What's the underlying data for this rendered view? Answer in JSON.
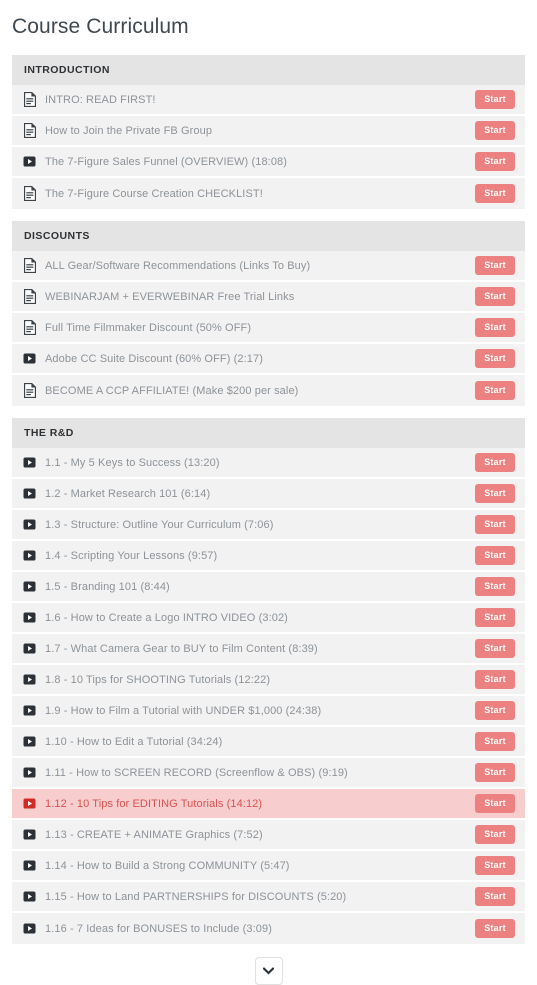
{
  "page": {
    "title": "Course Curriculum"
  },
  "icons": {
    "document": "document-icon",
    "video": "video-play-icon",
    "chevron_down": "chevron-down-icon"
  },
  "buttons": {
    "start_label": "Start"
  },
  "colors": {
    "accent": "#ed8080",
    "highlight_row_bg": "#f7cdcd",
    "highlight_text": "#d9534f",
    "row_bg": "#f2f2f2",
    "section_header_bg": "#e4e4e4",
    "label_text": "#8d9399",
    "title_text": "#40484f"
  },
  "sections": [
    {
      "title": "INTRODUCTION",
      "lessons": [
        {
          "icon": "document",
          "label": "INTRO: READ FIRST!",
          "action": "Start",
          "highlighted": false
        },
        {
          "icon": "document",
          "label": "How to Join the Private FB Group",
          "action": "Start",
          "highlighted": false
        },
        {
          "icon": "video",
          "label": "The 7-Figure Sales Funnel (OVERVIEW) (18:08)",
          "action": "Start",
          "highlighted": false
        },
        {
          "icon": "document",
          "label": "The 7-Figure Course Creation CHECKLIST!",
          "action": "Start",
          "highlighted": false
        }
      ]
    },
    {
      "title": "DISCOUNTS",
      "lessons": [
        {
          "icon": "document",
          "label": "ALL Gear/Software Recommendations (Links To Buy)",
          "action": "Start",
          "highlighted": false
        },
        {
          "icon": "document",
          "label": "WEBINARJAM + EVERWEBINAR Free Trial Links",
          "action": "Start",
          "highlighted": false
        },
        {
          "icon": "document",
          "label": "Full Time Filmmaker Discount (50% OFF)",
          "action": "Start",
          "highlighted": false
        },
        {
          "icon": "video",
          "label": "Adobe CC Suite Discount (60% OFF) (2:17)",
          "action": "Start",
          "highlighted": false
        },
        {
          "icon": "document",
          "label": "BECOME A CCP AFFILIATE! (Make $200 per sale)",
          "action": "Start",
          "highlighted": false
        }
      ]
    },
    {
      "title": "THE R&D",
      "lessons": [
        {
          "icon": "video",
          "label": "1.1 - My 5 Keys to Success (13:20)",
          "action": "Start",
          "highlighted": false
        },
        {
          "icon": "video",
          "label": "1.2 - Market Research 101 (6:14)",
          "action": "Start",
          "highlighted": false
        },
        {
          "icon": "video",
          "label": "1.3 - Structure: Outline Your Curriculum (7:06)",
          "action": "Start",
          "highlighted": false
        },
        {
          "icon": "video",
          "label": "1.4 - Scripting Your Lessons (9:57)",
          "action": "Start",
          "highlighted": false
        },
        {
          "icon": "video",
          "label": "1.5 - Branding 101 (8:44)",
          "action": "Start",
          "highlighted": false
        },
        {
          "icon": "video",
          "label": "1.6 - How to Create a Logo INTRO VIDEO (3:02)",
          "action": "Start",
          "highlighted": false
        },
        {
          "icon": "video",
          "label": "1.7 - What Camera Gear to BUY to Film Content (8:39)",
          "action": "Start",
          "highlighted": false
        },
        {
          "icon": "video",
          "label": "1.8 - 10 Tips for SHOOTING Tutorials (12:22)",
          "action": "Start",
          "highlighted": false
        },
        {
          "icon": "video",
          "label": "1.9 - How to Film a Tutorial with UNDER $1,000 (24:38)",
          "action": "Start",
          "highlighted": false
        },
        {
          "icon": "video",
          "label": "1.10 - How to Edit a Tutorial (34:24)",
          "action": "Start",
          "highlighted": false
        },
        {
          "icon": "video",
          "label": "1.11 - How to SCREEN RECORD (Screenflow & OBS) (9:19)",
          "action": "Start",
          "highlighted": false
        },
        {
          "icon": "video",
          "label": "1.12 - 10 Tips for EDITING Tutorials (14:12)",
          "action": "Start",
          "highlighted": true
        },
        {
          "icon": "video",
          "label": "1.13 - CREATE + ANIMATE Graphics (7:52)",
          "action": "Start",
          "highlighted": false
        },
        {
          "icon": "video",
          "label": "1.14 - How to Build a Strong COMMUNITY (5:47)",
          "action": "Start",
          "highlighted": false
        },
        {
          "icon": "video",
          "label": "1.15 - How to Land PARTNERSHIPS for DISCOUNTS (5:20)",
          "action": "Start",
          "highlighted": false
        },
        {
          "icon": "video",
          "label": "1.16 - 7 Ideas for BONUSES to Include (3:09)",
          "action": "Start",
          "highlighted": false
        }
      ]
    }
  ],
  "footer": {
    "expand_label": "chevron-down-icon"
  }
}
